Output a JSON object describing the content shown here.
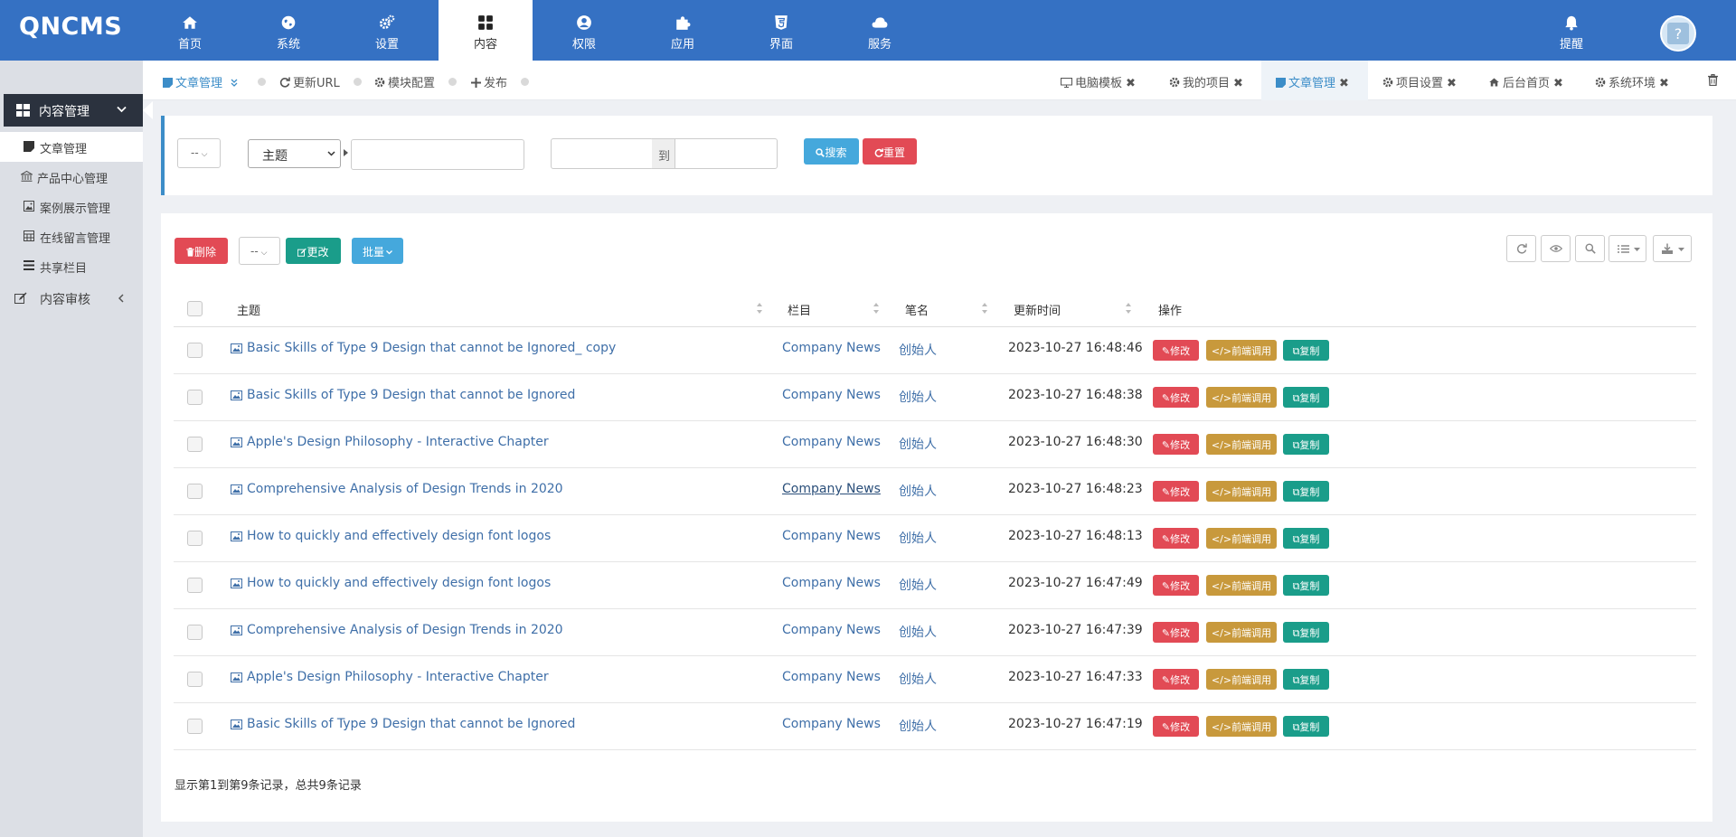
{
  "app": {
    "logo": "QNCMS"
  },
  "topnav": [
    {
      "label": "首页",
      "icon": "home-icon"
    },
    {
      "label": "系统",
      "icon": "globe-icon"
    },
    {
      "label": "设置",
      "icon": "cogs-icon"
    },
    {
      "label": "内容",
      "icon": "grid-icon",
      "active": true
    },
    {
      "label": "权限",
      "icon": "user-icon"
    },
    {
      "label": "应用",
      "icon": "puzzle-icon"
    },
    {
      "label": "界面",
      "icon": "html5-icon"
    },
    {
      "label": "服务",
      "icon": "cloud-icon"
    }
  ],
  "topbar": {
    "bell_label": "提醒",
    "avatar_text": "?"
  },
  "sidebar": {
    "head": "内容管理",
    "items": [
      {
        "label": "文章管理",
        "icon": "file-icon",
        "current": true
      },
      {
        "label": "产品中心管理",
        "icon": "bank-icon"
      },
      {
        "label": "案例展示管理",
        "icon": "image-icon"
      },
      {
        "label": "在线留言管理",
        "icon": "table-icon"
      },
      {
        "label": "共享栏目",
        "icon": "list-icon"
      }
    ],
    "review": "内容审核"
  },
  "crumbs": [
    "文章管理",
    "更新URL",
    "模块配置",
    "发布"
  ],
  "pagetabs": [
    "电脑模板",
    "我的项目",
    "文章管理",
    "项目设置",
    "后台首页",
    "系统环境"
  ],
  "search": {
    "scope_value": "--",
    "field_value": "主题",
    "date_to": "到",
    "search_btn": "搜索",
    "reset_btn": "重置"
  },
  "toolbar": {
    "delete": "删除",
    "status_value": "--",
    "update": "更改",
    "batch": "批量"
  },
  "table": {
    "columns": [
      "主题",
      "栏目",
      "笔名",
      "更新时间",
      "操作"
    ],
    "actions": {
      "edit": "修改",
      "frontend": "前端调用",
      "copy": "复制"
    },
    "rows": [
      {
        "title": "Basic Skills of Type 9 Design that cannot be Ignored_ copy",
        "category": "Company News",
        "author": "创始人",
        "time": "2023-10-27 16:48:46"
      },
      {
        "title": "Basic Skills of Type 9 Design that cannot be Ignored",
        "category": "Company News",
        "author": "创始人",
        "time": "2023-10-27 16:48:38"
      },
      {
        "title": "Apple's Design Philosophy - Interactive Chapter",
        "category": "Company News",
        "author": "创始人",
        "time": "2023-10-27 16:48:30"
      },
      {
        "title": "Comprehensive Analysis of Design Trends in 2020",
        "category": "Company News",
        "author": "创始人",
        "time": "2023-10-27 16:48:23"
      },
      {
        "title": "How to quickly and effectively design font logos",
        "category": "Company News",
        "author": "创始人",
        "time": "2023-10-27 16:48:13"
      },
      {
        "title": "How to quickly and effectively design font logos",
        "category": "Company News",
        "author": "创始人",
        "time": "2023-10-27 16:47:49"
      },
      {
        "title": "Comprehensive Analysis of Design Trends in 2020",
        "category": "Company News",
        "author": "创始人",
        "time": "2023-10-27 16:47:39"
      },
      {
        "title": "Apple's Design Philosophy - Interactive Chapter",
        "category": "Company News",
        "author": "创始人",
        "time": "2023-10-27 16:47:33"
      },
      {
        "title": "Basic Skills of Type 9 Design that cannot be Ignored",
        "category": "Company News",
        "author": "创始人",
        "time": "2023-10-27 16:47:19"
      }
    ]
  },
  "footer": {
    "summary": "显示第1到第9条记录，总共9条记录"
  },
  "colors": {
    "topbar": "#3571c3",
    "sidebar_head": "#2b323e",
    "link": "#3f6fa8",
    "danger": "#e24a55",
    "warning": "#c8993c",
    "success": "#1a9d8a",
    "info": "#45a8dc"
  }
}
